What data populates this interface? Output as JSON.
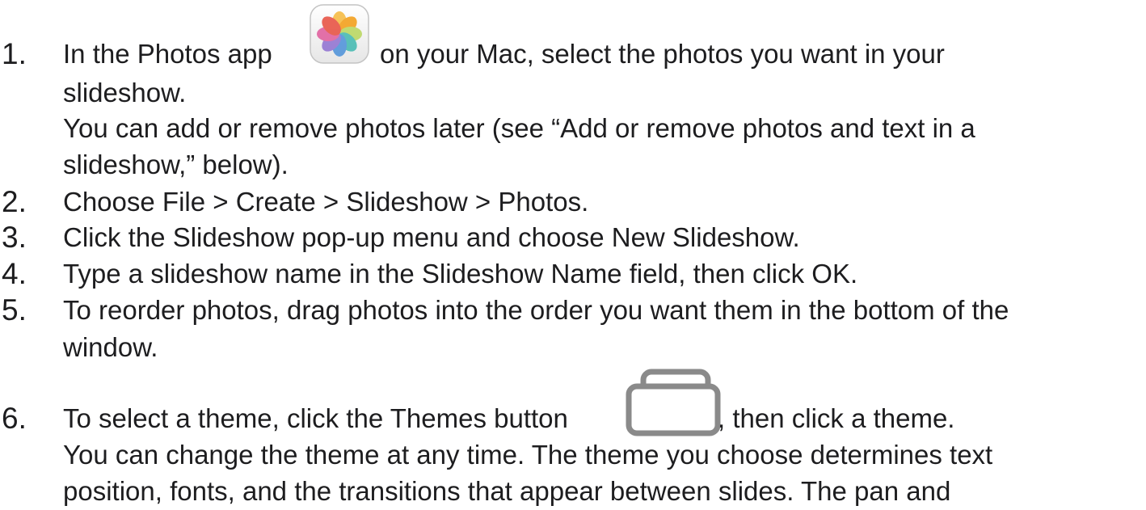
{
  "steps": [
    {
      "number": "1.",
      "text_before_icon": "In the Photos app",
      "icon": "photos-app-icon",
      "text_after_icon": "on your Mac, select the photos you want in your",
      "continuation": "slideshow.",
      "note_line1": "You can add or remove photos later (see “Add or remove photos and text in a",
      "note_line2": "slideshow,” below)."
    },
    {
      "number": "2.",
      "text": "Choose File > Create > Slideshow > Photos."
    },
    {
      "number": "3.",
      "text": "Click the Slideshow pop-up menu and choose New Slideshow."
    },
    {
      "number": "4.",
      "text": "Type a slideshow name in the Slideshow Name field, then click OK."
    },
    {
      "number": "5.",
      "text": "To reorder photos, drag photos into the order you want them in the bottom of the",
      "continuation": "window."
    },
    {
      "number": "6.",
      "text_before_icon": "To select a theme, click the Themes button",
      "icon": "themes-button-icon",
      "text_after_icon": ", then click a theme.",
      "note_line1": "You can change the theme at any time. The theme you choose determines text",
      "note_line2": "position, fonts, and the transitions that appear between slides. The pan and"
    }
  ]
}
